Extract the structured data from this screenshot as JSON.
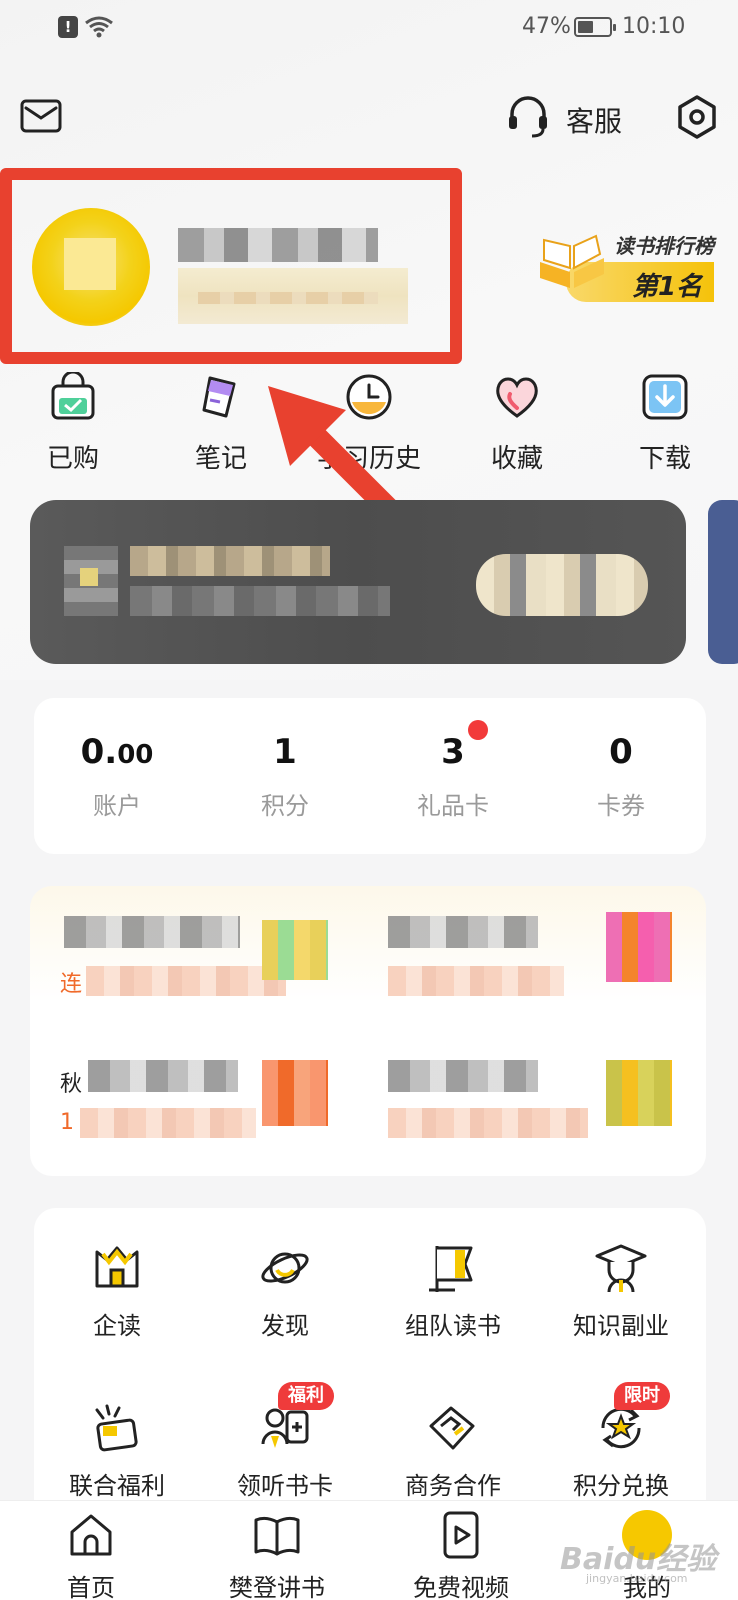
{
  "status_bar": {
    "battery_percent": "47%",
    "time": "10:10",
    "alert_glyph": "!"
  },
  "header": {
    "customer_service_label": "客服",
    "icons": [
      "mail-icon",
      "headset-icon",
      "settings-hexagon-icon"
    ]
  },
  "profile": {
    "rank_title": "读书排行榜",
    "rank_value": "第1名"
  },
  "quick_actions": [
    {
      "label": "已购",
      "icon": "shopping-bag-icon"
    },
    {
      "label": "笔记",
      "icon": "note-cup-icon"
    },
    {
      "label": "学习历史",
      "icon": "clock-icon"
    },
    {
      "label": "收藏",
      "icon": "heart-icon"
    },
    {
      "label": "下载",
      "icon": "download-icon"
    }
  ],
  "wallet": [
    {
      "value_main": "0.",
      "value_small": "00",
      "label": "账户"
    },
    {
      "value_main": "1",
      "value_small": "",
      "label": "积分"
    },
    {
      "value_main": "3",
      "value_small": "",
      "label": "礼品卡"
    },
    {
      "value_main": "0",
      "value_small": "",
      "label": "卡券"
    }
  ],
  "promo": {
    "visible_fragments": [
      "连",
      "秋",
      "1"
    ]
  },
  "grid": [
    {
      "label": "企读",
      "icon": "enterprise-read-icon",
      "badge": ""
    },
    {
      "label": "发现",
      "icon": "planet-icon",
      "badge": ""
    },
    {
      "label": "组队读书",
      "icon": "flag-icon",
      "badge": ""
    },
    {
      "label": "知识副业",
      "icon": "graduation-cap-icon",
      "badge": ""
    },
    {
      "label": "联合福利",
      "icon": "wallet-sparkle-icon",
      "badge": ""
    },
    {
      "label": "领听书卡",
      "icon": "people-card-icon",
      "badge": "福利"
    },
    {
      "label": "商务合作",
      "icon": "handshake-icon",
      "badge": ""
    },
    {
      "label": "积分兑换",
      "icon": "star-refresh-icon",
      "badge": "限时"
    }
  ],
  "bottom_nav": [
    {
      "label": "首页",
      "icon": "home-icon"
    },
    {
      "label": "樊登讲书",
      "icon": "open-book-icon"
    },
    {
      "label": "免费视频",
      "icon": "video-play-icon"
    },
    {
      "label": "我的",
      "icon": "avatar-face-icon"
    }
  ],
  "watermark": {
    "text": "Baidu经验",
    "sub": "jingyan.baidu.com"
  },
  "colors": {
    "highlight_red": "#e8412f",
    "brand_yellow": "#f5c800",
    "badge_red": "#ef3b3b",
    "promo_orange": "#f06a2a"
  }
}
